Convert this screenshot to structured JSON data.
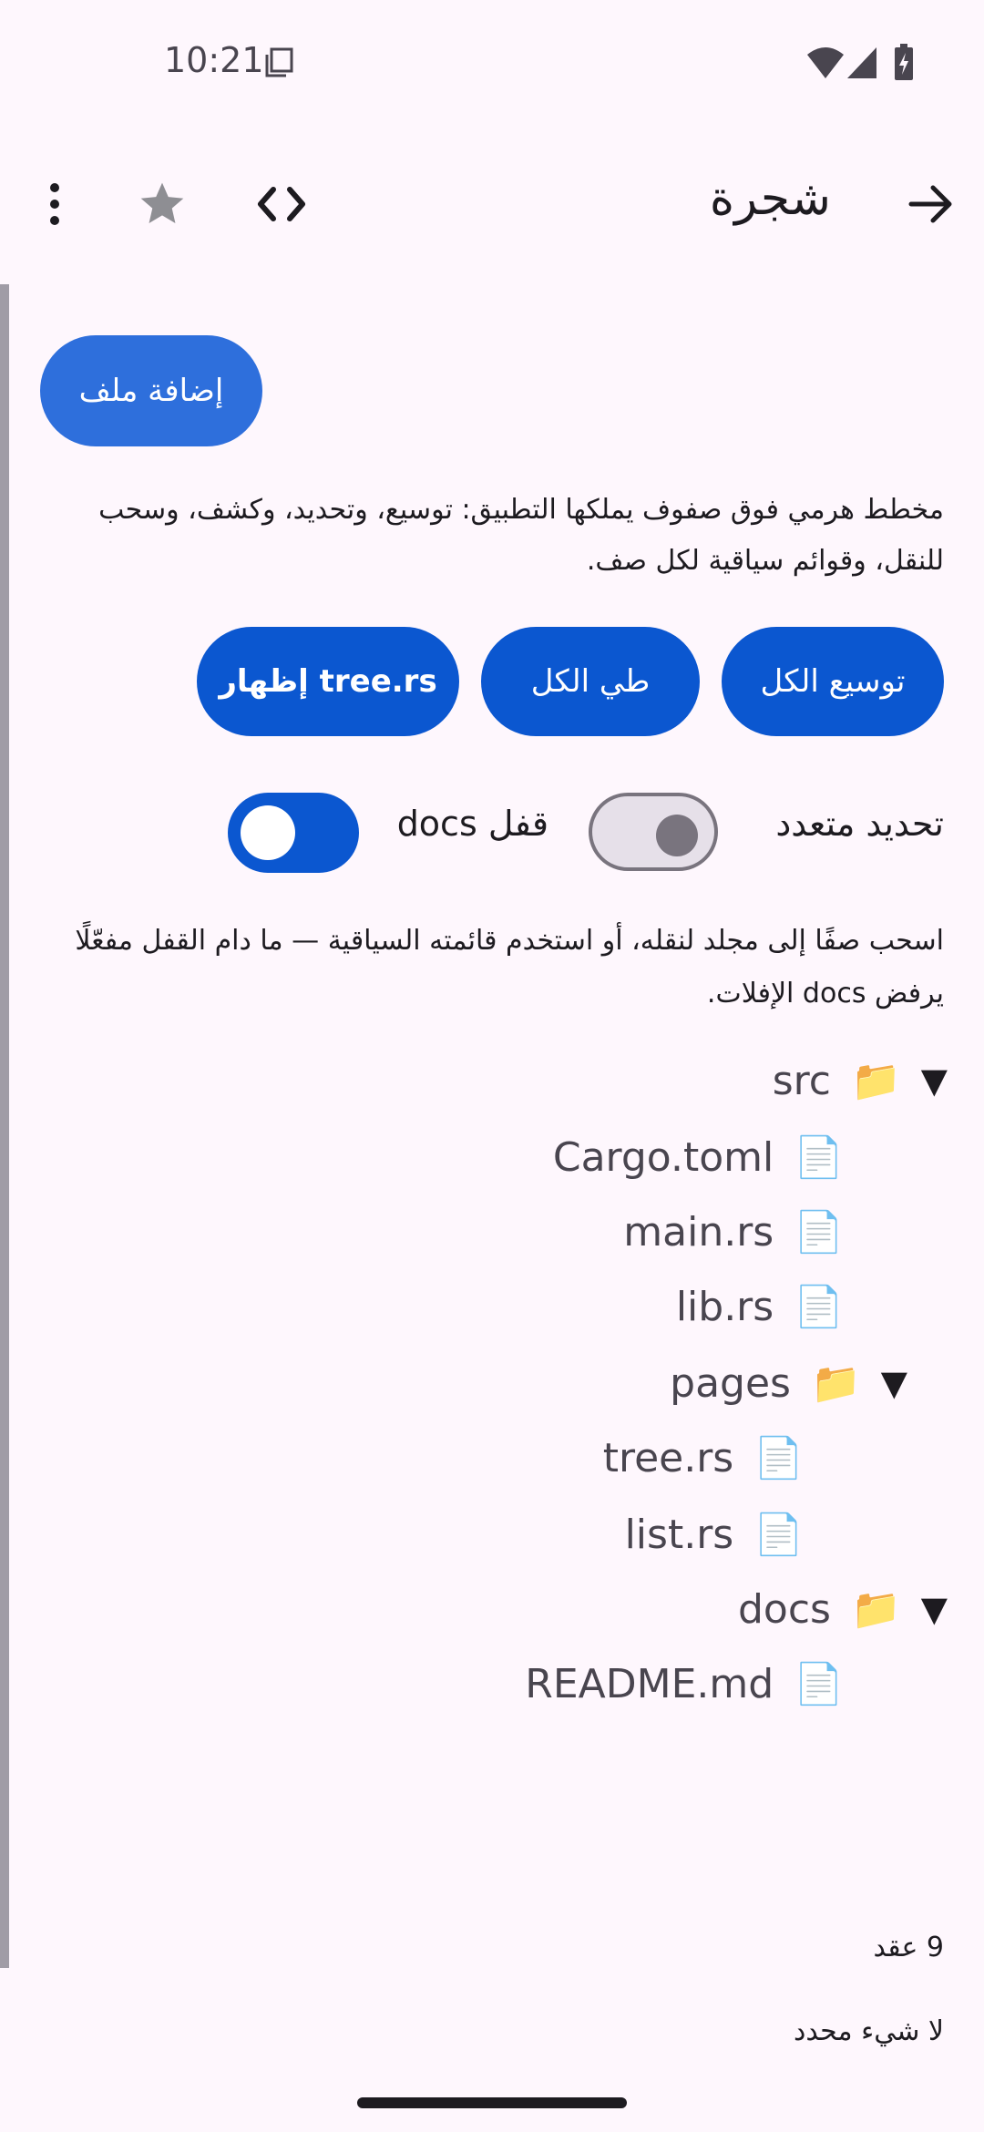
{
  "status_bar": {
    "time": "10:21"
  },
  "app_bar": {
    "title": "شجرة"
  },
  "actions": {
    "add_file": "إضافة ملف"
  },
  "description": "مخطط هرمي فوق صفوف يملكها التطبيق: توسيع، وتحديد، وكشف، وسحب للنقل، وقوائم سياقية لكل صف.",
  "buttons": {
    "expand_all": "توسيع الكل",
    "collapse_all": "طي الكل",
    "reveal": "إظهار tree.rs"
  },
  "switches": {
    "multi_select": "تحديد متعدد",
    "lock_docs": "قفل docs"
  },
  "hint": "اسحب صفًا إلى مجلد لنقله، أو استخدم قائمته السياقية — ما دام القفل مفعّلًا يرفض docs الإفلات.",
  "tree": [
    {
      "label": "src"
    },
    {
      "label": "Cargo.toml"
    },
    {
      "label": "main.rs"
    },
    {
      "label": "lib.rs"
    },
    {
      "label": "pages"
    },
    {
      "label": "tree.rs"
    },
    {
      "label": "list.rs"
    },
    {
      "label": "docs"
    },
    {
      "label": "README.md"
    }
  ],
  "footer": {
    "count": "9 عقد",
    "selection": "لا شيء محدد"
  }
}
